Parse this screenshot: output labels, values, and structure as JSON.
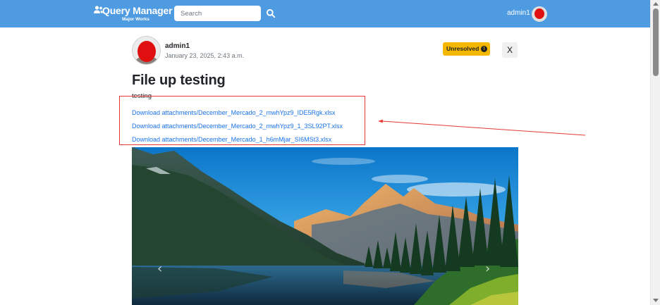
{
  "navbar": {
    "brand_title": "Query Manager",
    "brand_subtitle": "Major Works",
    "brand_icon": "users-icon",
    "search_placeholder": "Search",
    "search_icon": "search-icon",
    "username": "admin1",
    "bg_color": "#4e9be1"
  },
  "post": {
    "author": "admin1",
    "date": "January 23, 2025, 2:43 a.m.",
    "status": "Unresolved",
    "status_icon": "!",
    "status_color": "#f5b800",
    "close_label": "X",
    "title": "File up testing",
    "body": "testing",
    "attachments": [
      "Download attachments/December_Mercado_2_mwhYpz9_IDE5Rgk.xlsx",
      "Download attachments/December_Mercado_2_mwhYpz9_1_3SL92PT.xlsx",
      "Download attachments/December_Mercado_1_h6mMjar_SI6MSt3.xlsx"
    ]
  },
  "carousel": {
    "prev_label": "‹",
    "next_label": "›",
    "image": "mountain-lake-landscape"
  },
  "annotation": {
    "color": "#e53935"
  }
}
